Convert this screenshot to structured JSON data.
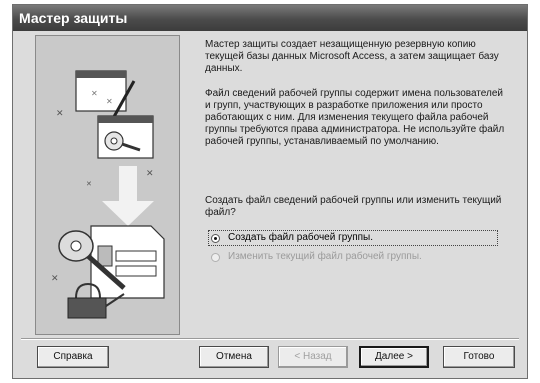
{
  "window": {
    "title": "Мастер защиты"
  },
  "content": {
    "paragraph1": "Мастер защиты создает незащищенную резервную копию текущей базы данных Microsoft Access, а затем защищает базу данных.",
    "paragraph2": "Файл сведений рабочей группы содержит имена пользователей и групп, участвующих в разработке приложения или просто работающих с ним. Для изменения текущего файла рабочей группы требуются права администратора. Не используйте файл рабочей группы, устанавливаемый по умолчанию.",
    "question": "Создать файл сведений рабочей группы или изменить текущий файл?",
    "options": [
      {
        "label": "Создать файл рабочей группы.",
        "selected": true,
        "enabled": true
      },
      {
        "label": "Изменить текущий файл рабочей группы.",
        "selected": false,
        "enabled": false
      }
    ]
  },
  "buttons": {
    "help": "Справка",
    "cancel": "Отмена",
    "back": "< Назад",
    "next": "Далее >",
    "finish": "Готово"
  },
  "illustration": {
    "icons": [
      "window-icon",
      "key-icon",
      "padlock-icon",
      "document-icon",
      "arrow-down-icon"
    ]
  }
}
